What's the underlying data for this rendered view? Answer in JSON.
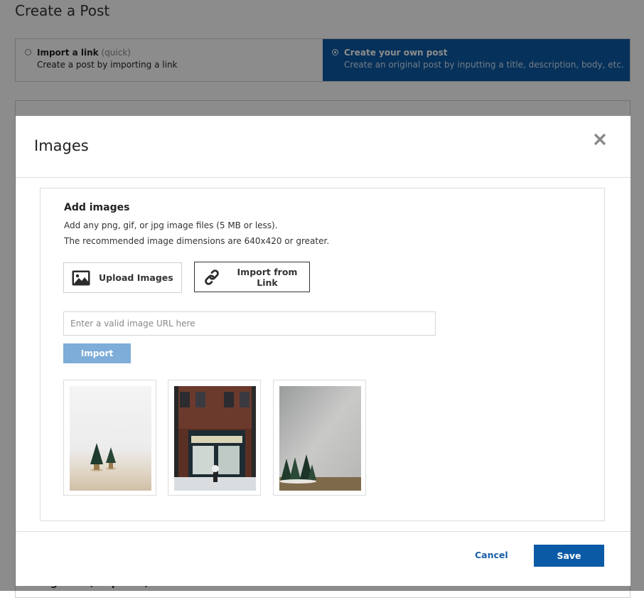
{
  "page": {
    "title": "Create a Post",
    "post_options": [
      {
        "title": "Import a link",
        "tag": "(quick)",
        "description": "Create a post by importing a link",
        "selected": false
      },
      {
        "title": "Create your own post",
        "tag": "",
        "description": "Create an original post by inputting a title, description, body, etc.",
        "selected": true
      }
    ],
    "categories_label": "Categories (Required)"
  },
  "modal": {
    "title": "Images",
    "close_icon": "close-icon",
    "section_heading": "Add images",
    "help_text_1": "Add any png, gif, or jpg image files (5 MB or less).",
    "help_text_2": "The recommended image dimensions are 640x420 or greater.",
    "upload_button": {
      "label": "Upload Images",
      "icon": "image-icon"
    },
    "link_button": {
      "label": "Import from Link",
      "icon": "link-icon"
    },
    "url_input": {
      "value": "",
      "placeholder": "Enter a valid image URL here"
    },
    "import_button": "Import",
    "footer": {
      "cancel": "Cancel",
      "save": "Save"
    }
  },
  "colors": {
    "primary": "#0b5aa5",
    "import_button_bg": "#7dadd8",
    "link": "#1a5fa8",
    "overlay": "rgba(0,0,0,0.45)"
  }
}
